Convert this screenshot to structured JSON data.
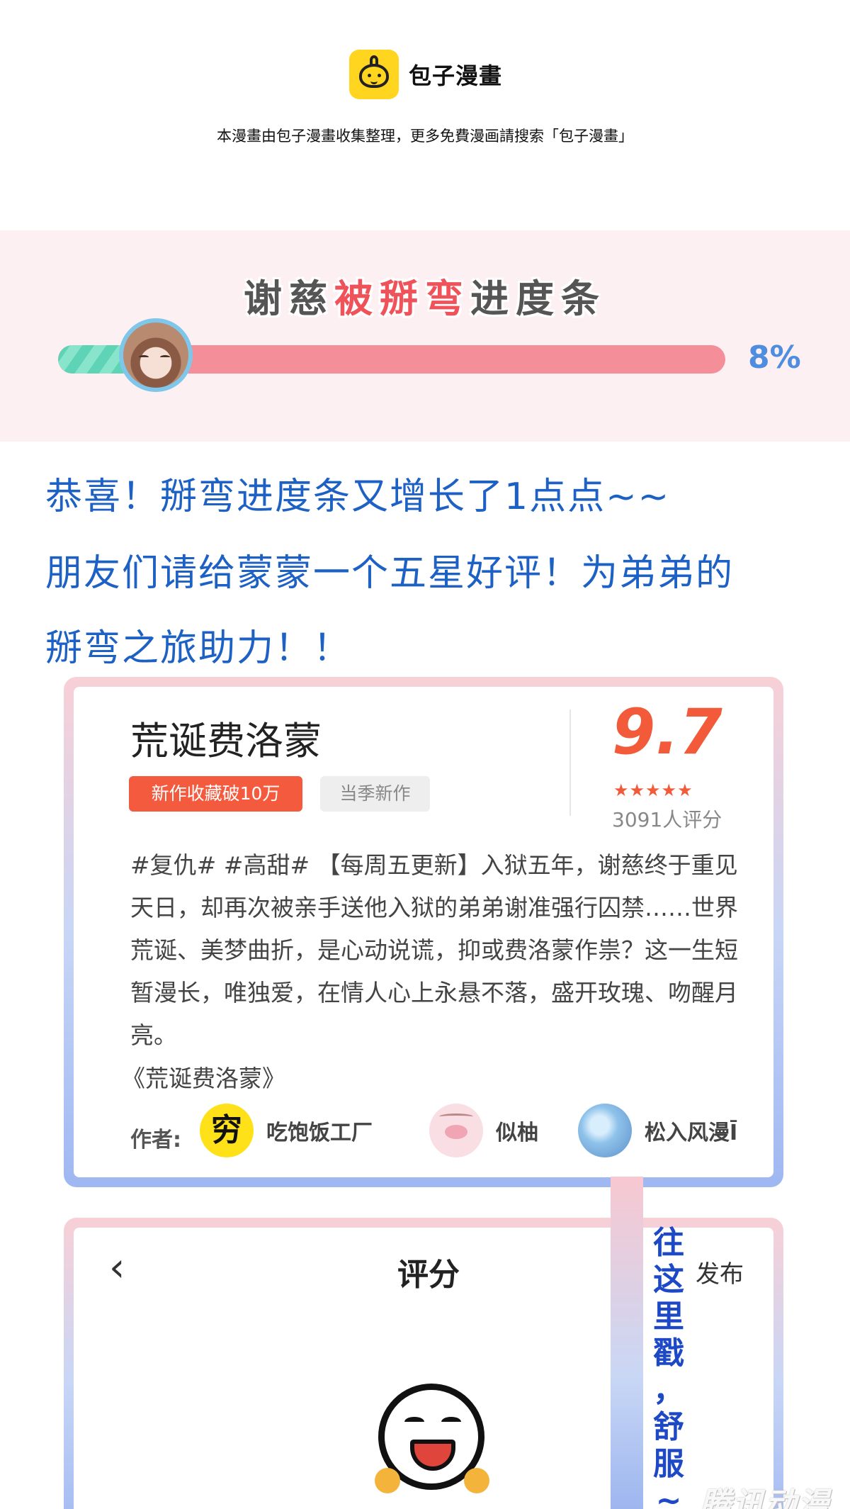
{
  "header": {
    "logo_text": "包子漫畫",
    "logo_icon": "bun-mascot-icon",
    "notice": "本漫畫由包子漫畫收集整理，更多免費漫画請搜索「包子漫畫」"
  },
  "progress_banner": {
    "title_part1": "谢慈",
    "title_part2": "被掰弯",
    "title_part3": "进度条",
    "progress_fraction": 0.08,
    "percent_text": "8%",
    "colors": {
      "fill": "#5fd3b6",
      "track": "#f48e99",
      "highlight": "#f0525a",
      "percent": "#4f8de0"
    }
  },
  "message": {
    "line1": "恭喜！掰弯进度条又增长了1点点~~",
    "line2": "朋友们请给蒙蒙一个五星好评！为弟弟的",
    "line3": "掰弯之旅助力！！",
    "color": "#1e61c4"
  },
  "comic_card": {
    "title": "荒诞费洛蒙",
    "tag_hot": "新作收藏破10万",
    "tag_new": "当季新作",
    "score": "9.7",
    "stars_filled": 4.5,
    "raters": "3091人评分",
    "description": "#复仇# #高甜# 【每周五更新】入狱五年，谢慈终于重见天日，却再次被亲手送他入狱的弟弟谢准强行囚禁……世界荒诞、美梦曲折，是心动说谎，抑或费洛蒙作祟？这一生短暂漫长，唯独爱，在情人心上永悬不落，盛开玫瑰、吻醒月亮。",
    "book_name": "《荒诞费洛蒙》",
    "authors_label": "作者:",
    "authors": [
      {
        "name": "吃饱饭工厂",
        "avatar_text": "穷"
      },
      {
        "name": "似柚",
        "avatar_text": ""
      },
      {
        "name": "松入风漫Ī",
        "avatar_text": ""
      }
    ]
  },
  "rating_page": {
    "back_icon": "chevron-left-icon",
    "title": "评分",
    "publish_label": "发布",
    "emoji": "laughing-face-icon"
  },
  "side_note": {
    "chars": [
      "往",
      "这",
      "里",
      "戳",
      "，",
      "舒",
      "服",
      "~"
    ]
  },
  "watermark": "腾讯动漫"
}
